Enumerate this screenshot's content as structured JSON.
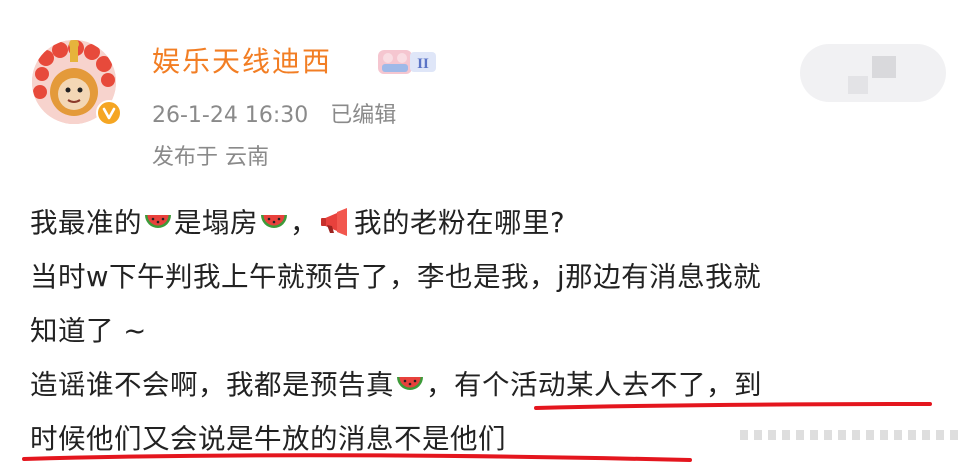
{
  "author": {
    "name": "娱乐天线迪西",
    "badge_icon": "gemini-badge-icon",
    "verified_icon": "verified-v-icon"
  },
  "meta": {
    "timestamp": "26-1-24 16:30",
    "edited": "已编辑",
    "location": "发布于 云南"
  },
  "post": {
    "line1_a": "我最准的",
    "line1_b": "是塌房",
    "line1_c": "，",
    "line1_d": "我的老粉在哪里?",
    "line2": "当时w下午判我上午就预告了，李也是我，j那边有消息我就",
    "line3": "知道了 ~",
    "line4_a": "造谣谁不会啊，我都是预告真",
    "line4_b": "，有个活动某人去不了，到",
    "line5": "时候他们又会说是牛放的消息不是他们"
  },
  "icons": {
    "emoji_watermelon": "watermelon-icon",
    "emoji_megaphone": "megaphone-icon"
  },
  "colors": {
    "username": "#f27e24",
    "meta": "#8a8a8a",
    "text": "#222222",
    "underline": "#e4161e"
  }
}
